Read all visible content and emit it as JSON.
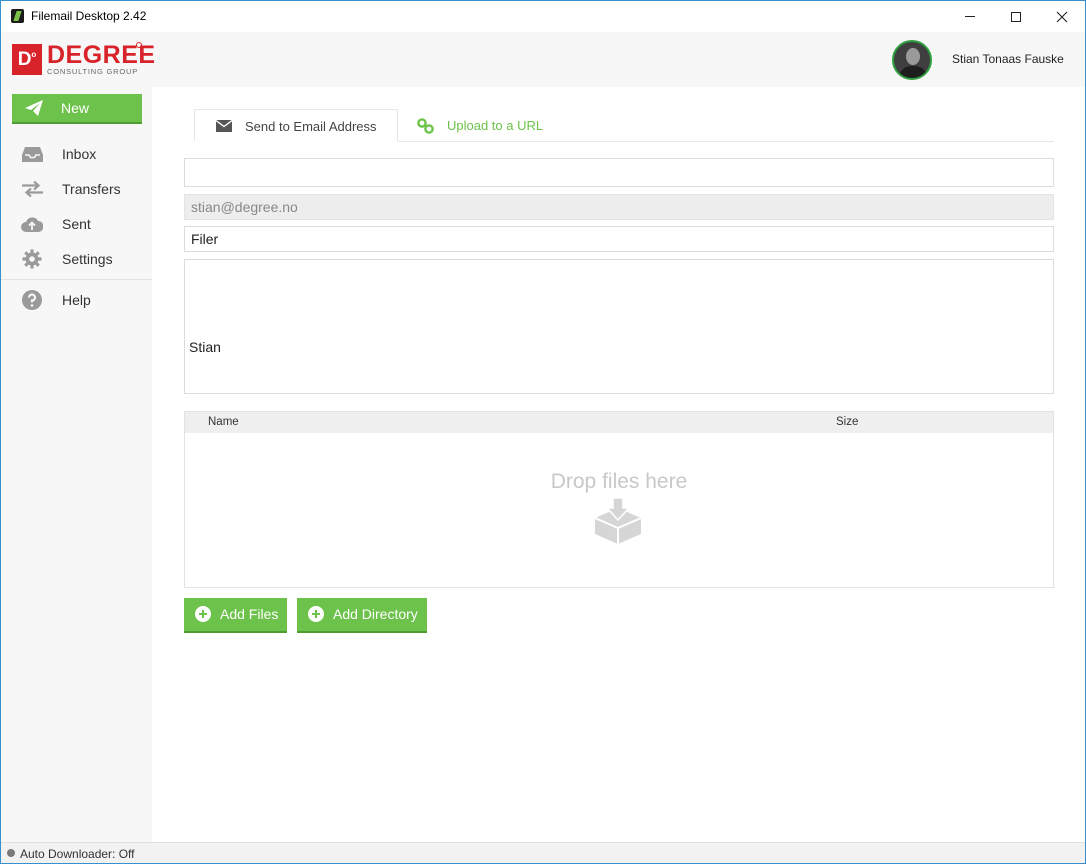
{
  "window": {
    "title": "Filemail Desktop 2.42"
  },
  "header": {
    "logo_main": "DEGREE",
    "logo_sub": "CONSULTING GROUP",
    "logo_mark": "D",
    "user_name": "Stian Tonaas Fauske"
  },
  "sidebar": {
    "new_label": "New",
    "items": [
      {
        "label": "Inbox",
        "icon": "inbox-icon"
      },
      {
        "label": "Transfers",
        "icon": "transfers-icon"
      },
      {
        "label": "Sent",
        "icon": "cloud-upload-icon"
      },
      {
        "label": "Settings",
        "icon": "gear-icon"
      },
      {
        "label": "Help",
        "icon": "help-icon"
      }
    ]
  },
  "tabs": [
    {
      "label": "Send to Email Address",
      "icon": "envelope-icon",
      "active": true
    },
    {
      "label": "Upload to a URL",
      "icon": "link-icon",
      "active": false
    }
  ],
  "form": {
    "to_value": "",
    "from_value": "stian@degree.no",
    "subject_value": "Filer",
    "message_value": "Stian"
  },
  "file_list": {
    "columns": [
      "Name",
      "Size"
    ],
    "drop_text": "Drop files here"
  },
  "buttons": {
    "add_files": "Add Files",
    "add_directory": "Add Directory"
  },
  "status": {
    "text": "Auto Downloader: Off"
  },
  "colors": {
    "accent": "#6cc24a",
    "brand": "#d8232a"
  }
}
